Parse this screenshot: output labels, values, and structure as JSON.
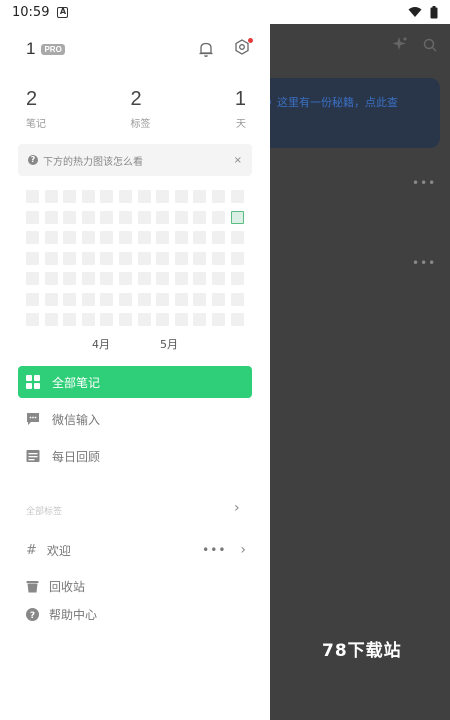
{
  "status_bar": {
    "time": "10:59",
    "badge": "A"
  },
  "drawer": {
    "user_number": "1",
    "pro_badge": "PRO",
    "stats": [
      {
        "value": "2",
        "label": "笔记"
      },
      {
        "value": "2",
        "label": "标签"
      },
      {
        "value": "1",
        "label": "天"
      }
    ],
    "hint": {
      "text": "下方的热力图该怎么看",
      "close": "×"
    },
    "heatmap": {
      "columns": 12,
      "rows": 7,
      "active_cells": [
        [
          11,
          1
        ]
      ]
    },
    "months": [
      "4月",
      "5月"
    ],
    "nav": [
      {
        "label": "全部笔记",
        "icon": "grid-icon",
        "active": true
      },
      {
        "label": "微信输入",
        "icon": "chat-icon",
        "active": false
      },
      {
        "label": "每日回顾",
        "icon": "calendar-review-icon",
        "active": false
      }
    ],
    "tags_section_title": "全部标签",
    "tag_item": {
      "hash": "#",
      "label": "欢迎",
      "more": "•••"
    },
    "trash_label": "回收站",
    "help_label": "帮助中心"
  },
  "background": {
    "banner_text": "》这里有一份秘籍，点此查",
    "dots": "•••",
    "watermark": "78下载站"
  },
  "colors": {
    "accent": "#2fcf79",
    "dot_red": "#e23c3c"
  }
}
